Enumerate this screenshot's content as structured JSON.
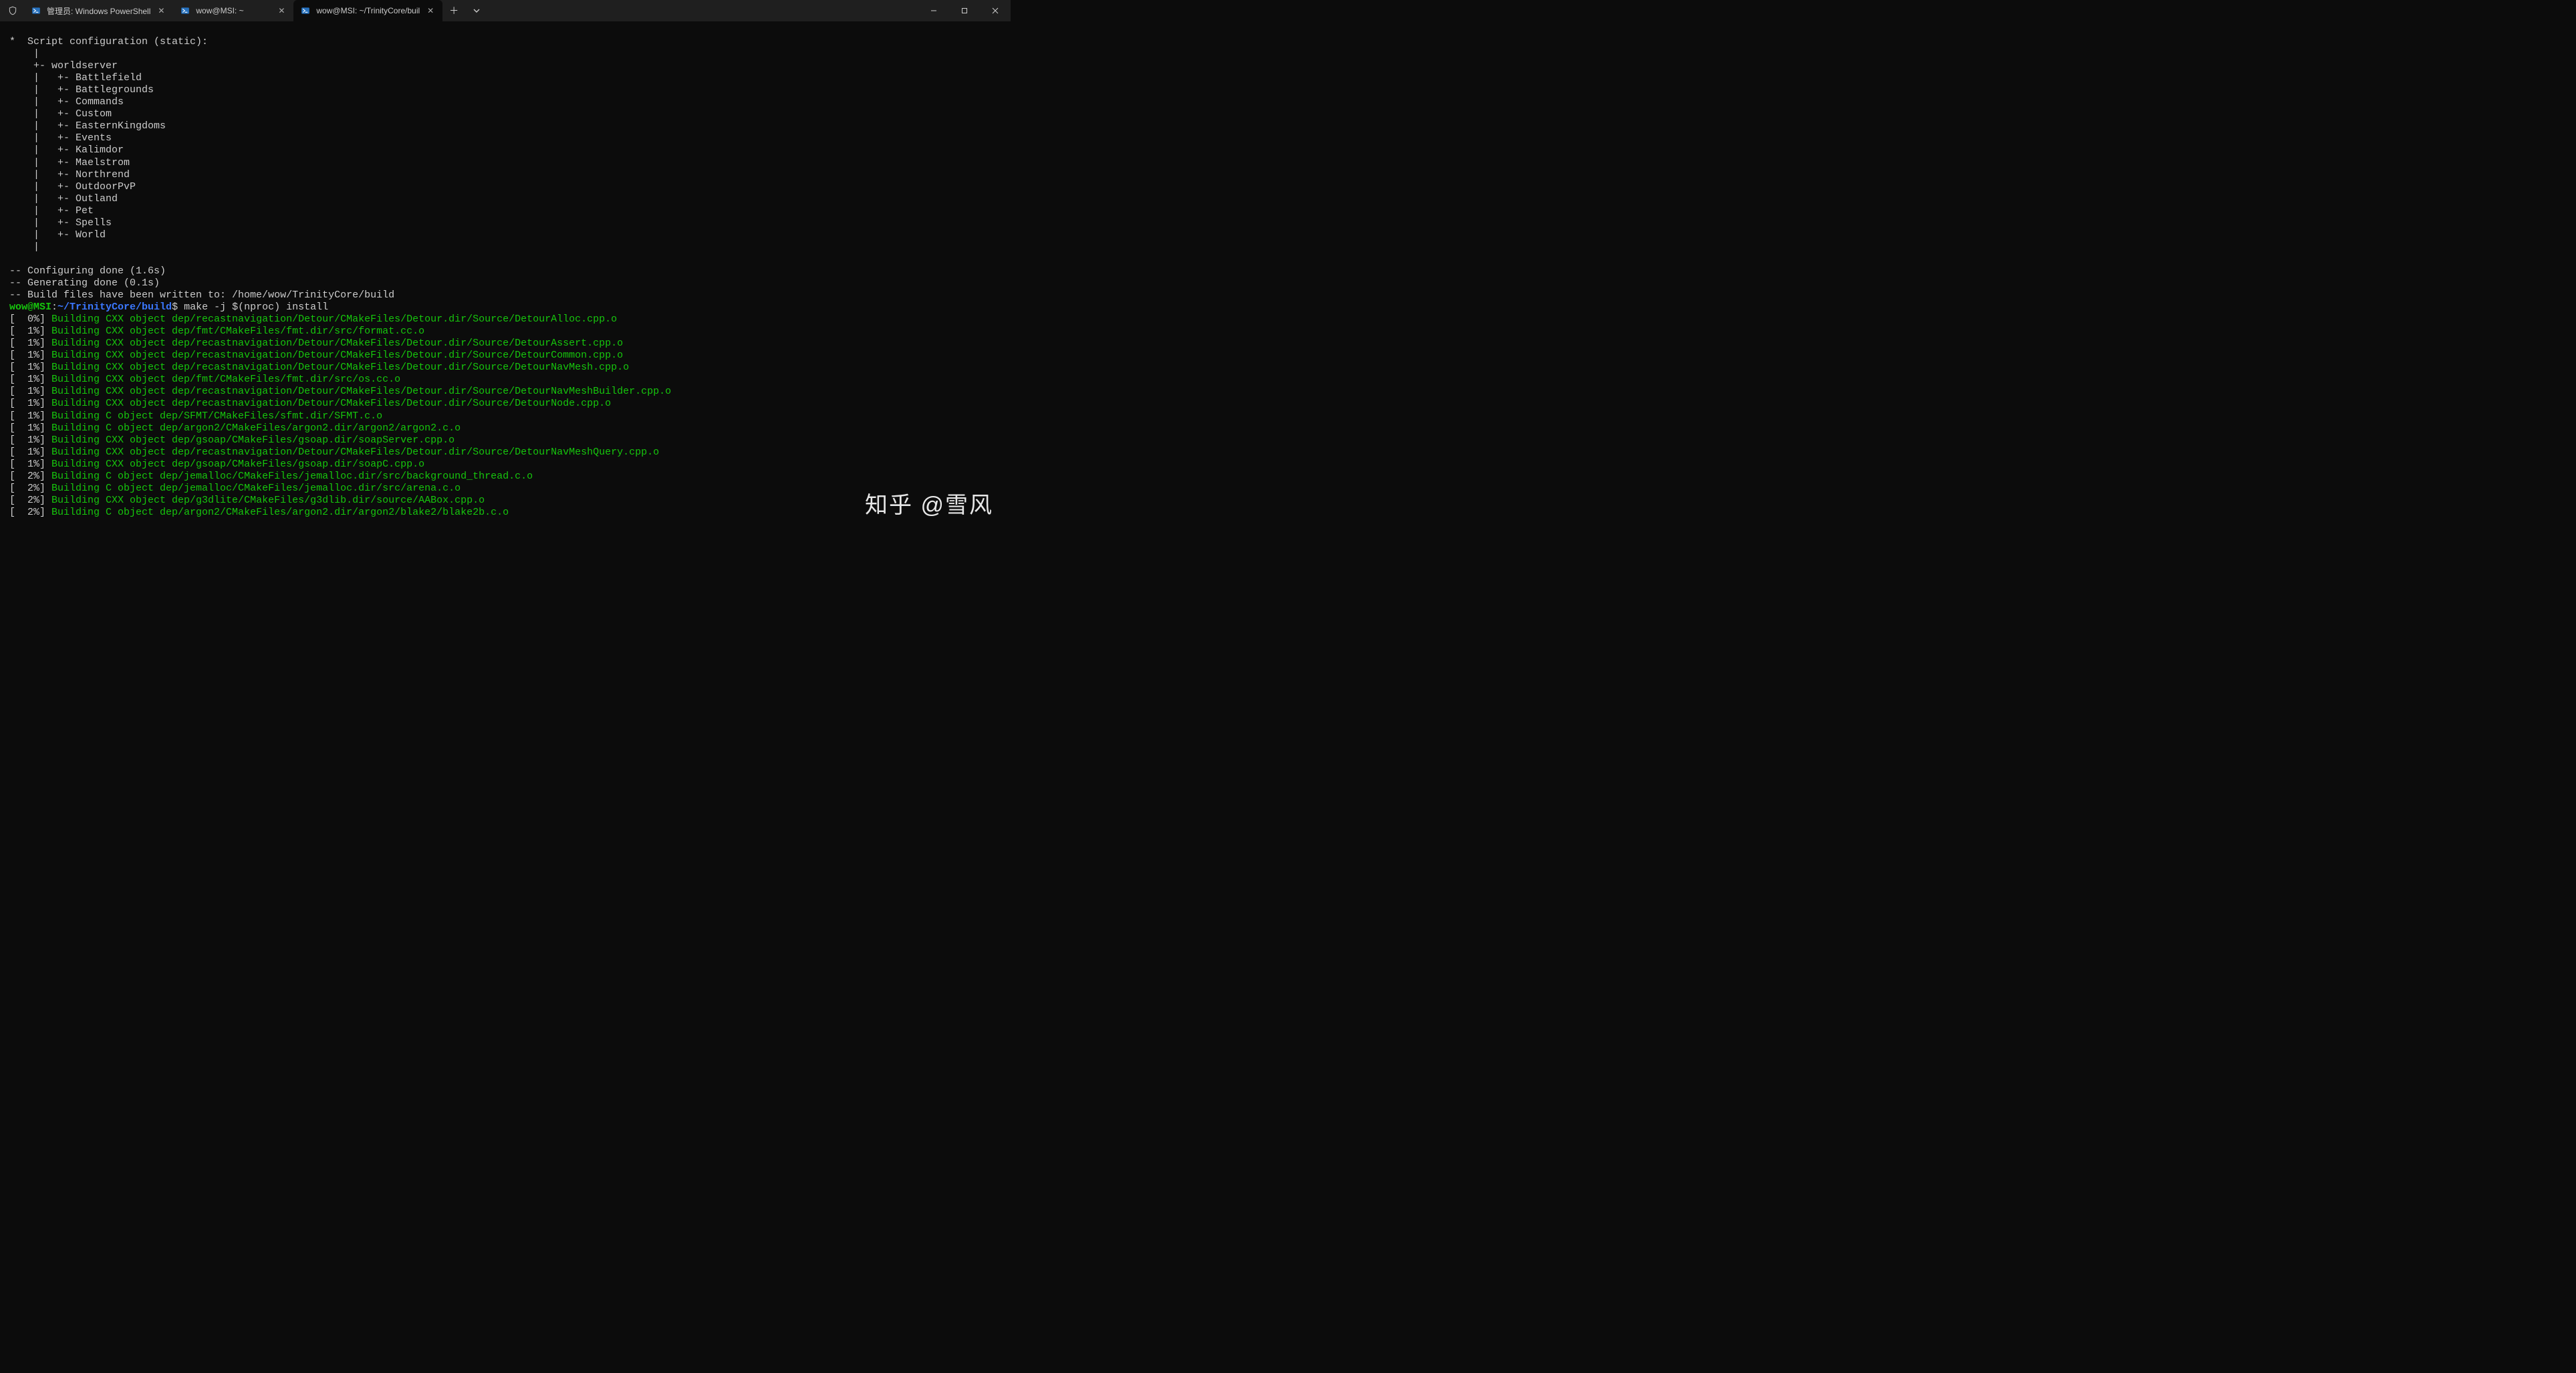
{
  "tabs": [
    {
      "title": "管理员: Windows PowerShell",
      "active": false
    },
    {
      "title": "wow@MSI: ~",
      "active": false
    },
    {
      "title": "wow@MSI: ~/TrinityCore/buil",
      "active": true
    }
  ],
  "scriptHeader": "*  Script configuration (static):",
  "treeRoot": "worldserver",
  "treeChildren": [
    "Battlefield",
    "Battlegrounds",
    "Commands",
    "Custom",
    "EasternKingdoms",
    "Events",
    "Kalimdor",
    "Maelstrom",
    "Northrend",
    "OutdoorPvP",
    "Outland",
    "Pet",
    "Spells",
    "World"
  ],
  "cmakeStatus": [
    "-- Configuring done (1.6s)",
    "-- Generating done (0.1s)",
    "-- Build files have been written to: /home/wow/TrinityCore/build"
  ],
  "prompt": {
    "user": "wow@MSI",
    "path": "~/TrinityCore/build",
    "command": "make -j $(nproc) install"
  },
  "buildLines": [
    {
      "pct": "  0%",
      "msg": "Building CXX object dep/recastnavigation/Detour/CMakeFiles/Detour.dir/Source/DetourAlloc.cpp.o"
    },
    {
      "pct": "  1%",
      "msg": "Building CXX object dep/fmt/CMakeFiles/fmt.dir/src/format.cc.o"
    },
    {
      "pct": "  1%",
      "msg": "Building CXX object dep/recastnavigation/Detour/CMakeFiles/Detour.dir/Source/DetourAssert.cpp.o"
    },
    {
      "pct": "  1%",
      "msg": "Building CXX object dep/recastnavigation/Detour/CMakeFiles/Detour.dir/Source/DetourCommon.cpp.o"
    },
    {
      "pct": "  1%",
      "msg": "Building CXX object dep/recastnavigation/Detour/CMakeFiles/Detour.dir/Source/DetourNavMesh.cpp.o"
    },
    {
      "pct": "  1%",
      "msg": "Building CXX object dep/fmt/CMakeFiles/fmt.dir/src/os.cc.o"
    },
    {
      "pct": "  1%",
      "msg": "Building CXX object dep/recastnavigation/Detour/CMakeFiles/Detour.dir/Source/DetourNavMeshBuilder.cpp.o"
    },
    {
      "pct": "  1%",
      "msg": "Building CXX object dep/recastnavigation/Detour/CMakeFiles/Detour.dir/Source/DetourNode.cpp.o"
    },
    {
      "pct": "  1%",
      "msg": "Building C object dep/SFMT/CMakeFiles/sfmt.dir/SFMT.c.o"
    },
    {
      "pct": "  1%",
      "msg": "Building C object dep/argon2/CMakeFiles/argon2.dir/argon2/argon2.c.o"
    },
    {
      "pct": "  1%",
      "msg": "Building CXX object dep/gsoap/CMakeFiles/gsoap.dir/soapServer.cpp.o"
    },
    {
      "pct": "  1%",
      "msg": "Building CXX object dep/recastnavigation/Detour/CMakeFiles/Detour.dir/Source/DetourNavMeshQuery.cpp.o"
    },
    {
      "pct": "  1%",
      "msg": "Building CXX object dep/gsoap/CMakeFiles/gsoap.dir/soapC.cpp.o"
    },
    {
      "pct": "  2%",
      "msg": "Building C object dep/jemalloc/CMakeFiles/jemalloc.dir/src/background_thread.c.o"
    },
    {
      "pct": "  2%",
      "msg": "Building C object dep/jemalloc/CMakeFiles/jemalloc.dir/src/arena.c.o"
    },
    {
      "pct": "  2%",
      "msg": "Building CXX object dep/g3dlite/CMakeFiles/g3dlib.dir/source/AABox.cpp.o"
    },
    {
      "pct": "  2%",
      "msg": "Building C object dep/argon2/CMakeFiles/argon2.dir/argon2/blake2/blake2b.c.o"
    }
  ],
  "watermark": "知乎 @雪风"
}
